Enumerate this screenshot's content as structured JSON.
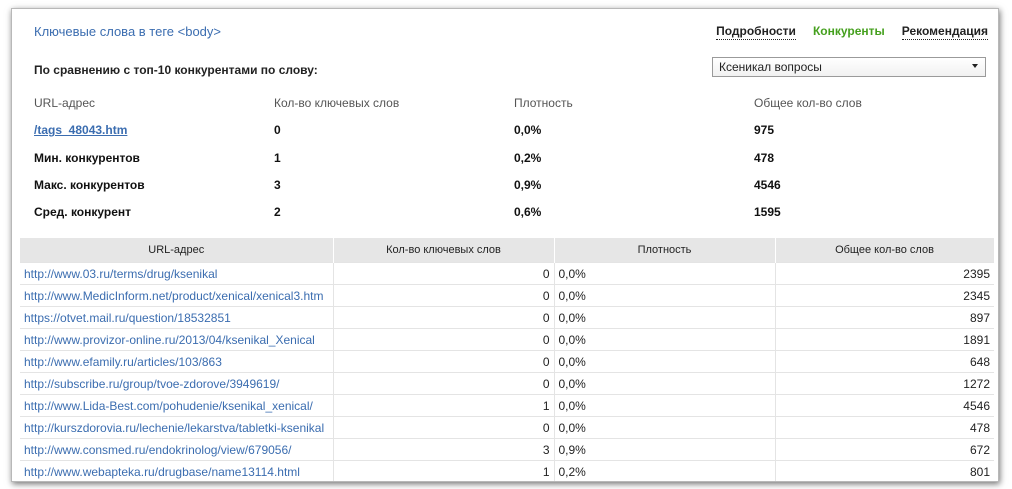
{
  "title": "Ключевые слова в теге <body>",
  "tabs": [
    {
      "label": "Подробности"
    },
    {
      "label": "Конкуренты"
    },
    {
      "label": "Рекомендация"
    }
  ],
  "compare_label": "По сравнению с топ-10 конкурентами по слову:",
  "keyword_select": {
    "value": "Ксеникал вопросы"
  },
  "summary": {
    "headers": [
      "URL-адрес",
      "Кол-во ключевых слов",
      "Плотность",
      "Общее кол-во слов"
    ],
    "rows": [
      {
        "label": "/tags_48043.htm",
        "keywords": "0",
        "density": "0,0%",
        "total": "975"
      },
      {
        "label": "Мин. конкурентов",
        "keywords": "1",
        "density": "0,2%",
        "total": "478"
      },
      {
        "label": "Макс. конкурентов",
        "keywords": "3",
        "density": "0,9%",
        "total": "4546"
      },
      {
        "label": "Сред. конкурент",
        "keywords": "2",
        "density": "0,6%",
        "total": "1595"
      }
    ]
  },
  "table": {
    "headers": [
      "URL-адрес",
      "Кол-во ключевых слов",
      "Плотность",
      "Общее кол-во слов"
    ],
    "rows": [
      {
        "url": "http://www.03.ru/terms/drug/ksenikal",
        "keywords": "0",
        "density": "0,0%",
        "total": "2395"
      },
      {
        "url": "http://www.MedicInform.net/product/xenical/xenical3.htm",
        "keywords": "0",
        "density": "0,0%",
        "total": "2345"
      },
      {
        "url": "https://otvet.mail.ru/question/18532851",
        "keywords": "0",
        "density": "0,0%",
        "total": "897"
      },
      {
        "url": "http://www.provizor-online.ru/2013/04/ksenikal_Xenical",
        "keywords": "0",
        "density": "0,0%",
        "total": "1891"
      },
      {
        "url": "http://www.efamily.ru/articles/103/863",
        "keywords": "0",
        "density": "0,0%",
        "total": "648"
      },
      {
        "url": "http://subscribe.ru/group/tvoe-zdorove/3949619/",
        "keywords": "0",
        "density": "0,0%",
        "total": "1272"
      },
      {
        "url": "http://www.Lida-Best.com/pohudenie/ksenikal_xenical/",
        "keywords": "1",
        "density": "0,0%",
        "total": "4546"
      },
      {
        "url": "http://kurszdorovia.ru/lechenie/lekarstva/tabletki-ksenikal",
        "keywords": "0",
        "density": "0,0%",
        "total": "478"
      },
      {
        "url": "http://www.consmed.ru/endokrinolog/view/679056/",
        "keywords": "3",
        "density": "0,9%",
        "total": "672"
      },
      {
        "url": "http://www.webapteka.ru/drugbase/name13114.html",
        "keywords": "1",
        "density": "0,2%",
        "total": "801"
      }
    ]
  }
}
